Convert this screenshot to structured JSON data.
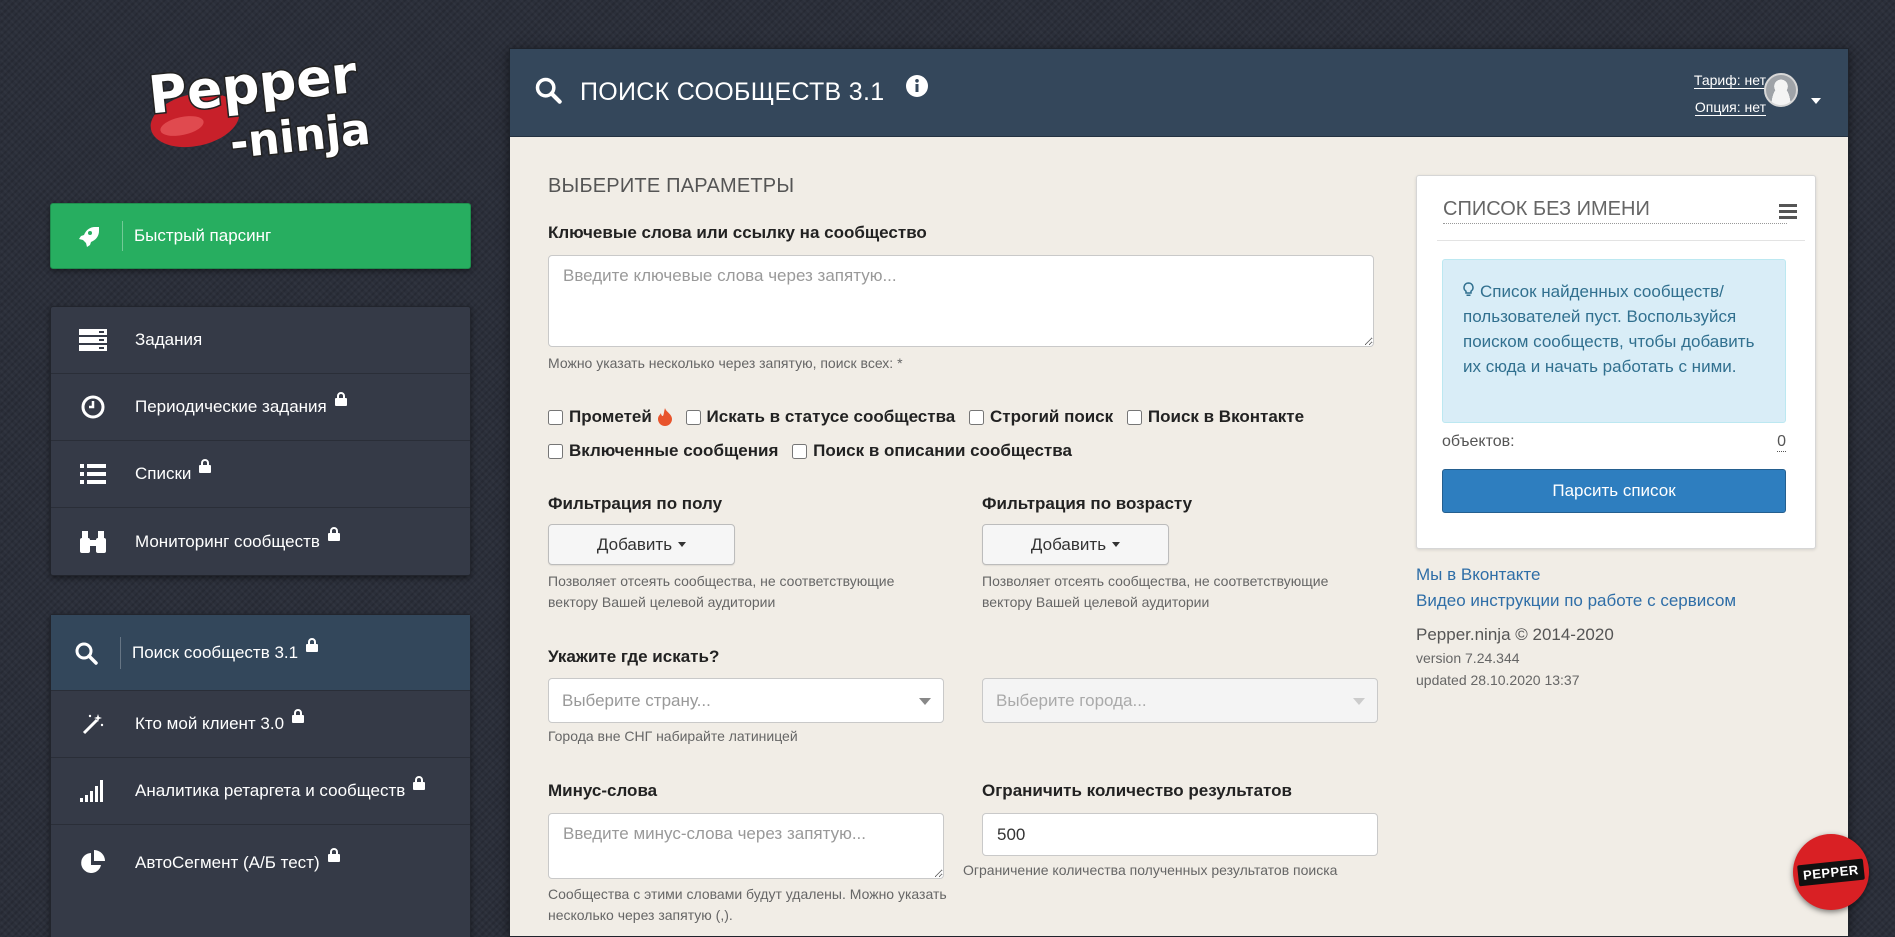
{
  "logo": {
    "line1": "Pepper",
    "line2": "-ninja"
  },
  "sidebar": {
    "quick_parse": "Быстрый парсинг",
    "group1": [
      {
        "label": "Задания",
        "icon": "server-icon",
        "locked": false
      },
      {
        "label": "Периодические задания",
        "icon": "clock-icon",
        "locked": true
      },
      {
        "label": "Списки",
        "icon": "list-icon",
        "locked": true
      },
      {
        "label": "Мониторинг сообществ",
        "icon": "binoculars-icon",
        "locked": true
      }
    ],
    "group2": [
      {
        "label": "Поиск сообществ 3.1",
        "icon": "search-icon",
        "locked": true,
        "active": true
      },
      {
        "label": "Кто мой клиент 3.0",
        "icon": "magic-wand-icon",
        "locked": true
      },
      {
        "label": "Аналитика ретаргета и сообществ",
        "icon": "signal-bars-icon",
        "locked": true
      },
      {
        "label": "АвтоСегмент (А/Б тест)",
        "icon": "pie-chart-icon",
        "locked": true
      }
    ]
  },
  "header": {
    "title": "ПОИСК СООБЩЕСТВ 3.1",
    "tariff": "Тариф: нет",
    "option": "Опция: нет"
  },
  "form": {
    "section_title": "ВЫБЕРИТЕ ПАРАМЕТРЫ",
    "keywords_label": "Ключевые слова или ссылку на сообщество",
    "keywords_placeholder": "Введите ключевые слова через запятую...",
    "keywords_help": "Можно указать несколько через запятую, поиск всех: *",
    "checkboxes_row1": [
      "Прометей",
      "Искать в статусе сообщества",
      "Строгий поиск",
      "Поиск в Вконтакте"
    ],
    "checkboxes_row2": [
      "Включенные сообщения",
      "Поиск в описании сообщества"
    ],
    "gender_label": "Фильтрация по полу",
    "age_label": "Фильтрация по возрасту",
    "add_button": "Добавить",
    "filter_help": "Позволяет отсеять сообщества, не соответствующие вектору Вашей целевой аудитории",
    "where_label": "Укажите где искать?",
    "country_placeholder": "Выберите страну...",
    "city_placeholder": "Выберите города...",
    "where_help": "Города вне СНГ набирайте латиницей",
    "minus_label": "Минус-слова",
    "minus_placeholder": "Введите минус-слова через запятую...",
    "minus_help": "Сообщества с этими словами будут удалены. Можно указать несколько через запятую (,).",
    "limit_label": "Ограничить количество результатов",
    "limit_value": "500",
    "limit_help": "Ограничение количества полученных результатов поиска"
  },
  "list_panel": {
    "title": "СПИСОК БЕЗ ИМЕНИ",
    "alert_text": "Список найденных сообществ/пользователей пуст. Воспользуйся поиском сообществ, чтобы добавить их сюда и начать работать с ними.",
    "objects_label": "объектов:",
    "objects_count": "0",
    "parse_button": "Парсить список"
  },
  "links": {
    "vk": "Мы в Вконтакте",
    "video": "Видео инструкции по работе с сервисом"
  },
  "footer": {
    "copyright": "Pepper.ninja © 2014-2020",
    "version": "version 7.24.344",
    "updated": "updated 28.10.2020 13:37"
  },
  "fab": {
    "label": "PEPPER"
  },
  "colors": {
    "accent_green": "#27ae60",
    "header_blue": "#34475b",
    "primary_button": "#2e7ebf",
    "fab_red": "#d92024",
    "alert_bg": "#d9edf7"
  }
}
